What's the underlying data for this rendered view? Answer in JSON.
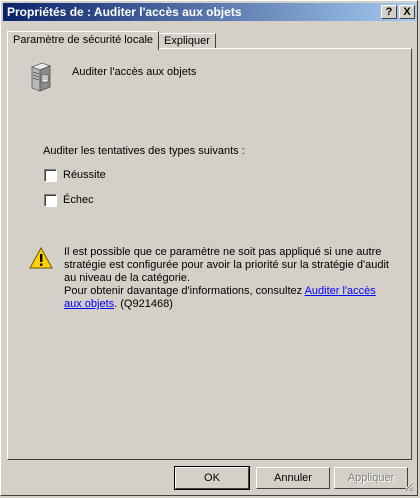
{
  "window": {
    "title": "Propriétés de : Auditer l'accès aux objets",
    "help_button": "?",
    "close_button": "X"
  },
  "tabs": [
    {
      "label": "Paramètre de sécurité locale",
      "active": true
    },
    {
      "label": "Expliquer",
      "active": false
    }
  ],
  "policy": {
    "name": "Auditer l'accès aux objets",
    "icon": "server-icon"
  },
  "audit": {
    "label": "Auditer les tentatives des types suivants :",
    "options": [
      {
        "label": "Réussite",
        "checked": false
      },
      {
        "label": "Échec",
        "checked": false
      }
    ]
  },
  "warning": {
    "icon": "warning-icon",
    "text": "Il est possible que ce paramètre ne soit pas appliqué si une autre stratégie est configurée pour avoir la priorité sur la stratégie d'audit au niveau de la catégorie.",
    "more_prefix": "Pour obtenir davantage d'informations, consultez ",
    "link_text": "Auditer l'accès aux objets",
    "suffix": ". (Q921468)"
  },
  "buttons": {
    "ok": "OK",
    "cancel": "Annuler",
    "apply": "Appliquer"
  }
}
